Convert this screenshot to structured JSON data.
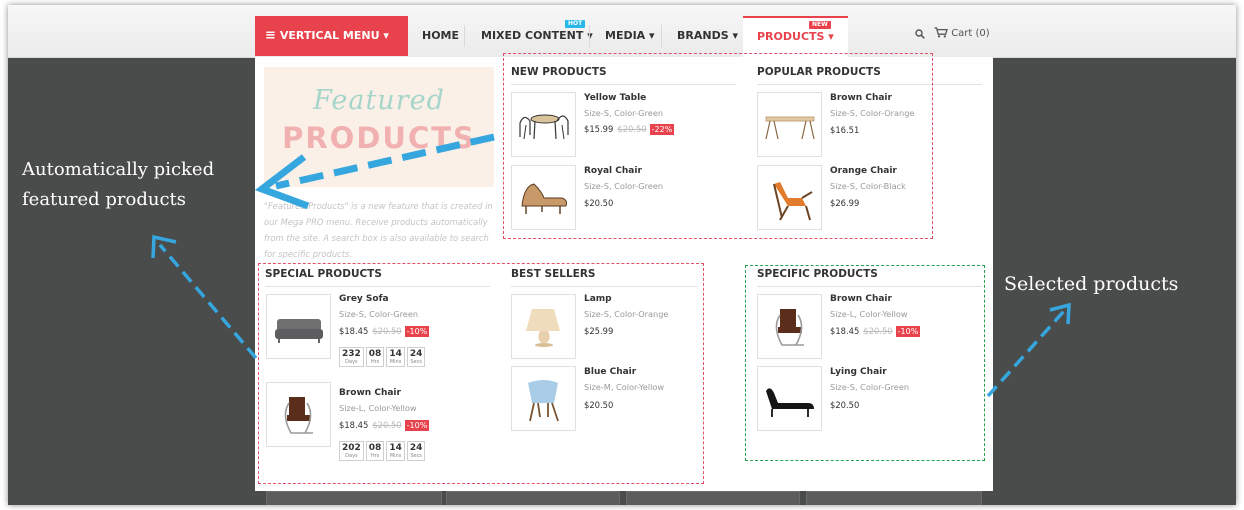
{
  "navigation": {
    "vertical_menu": "VERTICAL MENU",
    "vertical_menu_arrow": "▾",
    "home": "HOME",
    "mixed_content": "MIXED CONTENT",
    "mixed_content_badge": "HOT",
    "media": "MEDIA",
    "brands": "BRANDS",
    "products": "PRODUCTS",
    "products_badge": "NEW",
    "dropdown_arrow": "▾",
    "search_icon": "search-icon",
    "cart_icon": "cart-icon",
    "cart_label": "Cart (0)"
  },
  "featured": {
    "script_text": "Featured",
    "block_text": "PRODUCTS",
    "description": "\"Featured Products\" is a new feature that is created in our Mega PRO menu. Receive products automatically from the site. A search box is also available to search for specific products."
  },
  "sections": {
    "new_products": {
      "title": "NEW PRODUCTS",
      "items": [
        {
          "name": "Yellow Table",
          "attributes": "Size-S, Color-Green",
          "price": "$15.99",
          "old_price": "$20.50",
          "discount": "-22%"
        },
        {
          "name": "Royal Chair",
          "attributes": "Size-S, Color-Green",
          "price": "$20.50"
        }
      ]
    },
    "popular_products": {
      "title": "POPULAR PRODUCTS",
      "items": [
        {
          "name": "Brown Chair",
          "attributes": "Size-S, Color-Orange",
          "price": "$16.51"
        },
        {
          "name": "Orange Chair",
          "attributes": "Size-S, Color-Black",
          "price": "$26.99"
        }
      ]
    },
    "special_products": {
      "title": "SPECIAL PRODUCTS",
      "items": [
        {
          "name": "Grey Sofa",
          "attributes": "Size-S, Color-Green",
          "price": "$18.45",
          "old_price": "$20.50",
          "discount": "-10%",
          "countdown": {
            "days": "232",
            "hrs": "08",
            "mins": "14",
            "secs": "24"
          }
        },
        {
          "name": "Brown Chair",
          "attributes": "Size-L, Color-Yellow",
          "price": "$18.45",
          "old_price": "$20.50",
          "discount": "-10%",
          "countdown": {
            "days": "202",
            "hrs": "08",
            "mins": "14",
            "secs": "24"
          }
        }
      ]
    },
    "best_sellers": {
      "title": "BEST SELLERS",
      "items": [
        {
          "name": "Lamp",
          "attributes": "Size-S, Color-Orange",
          "price": "$25.99"
        },
        {
          "name": "Blue Chair",
          "attributes": "Size-M, Color-Yellow",
          "price": "$20.50"
        }
      ]
    },
    "specific_products": {
      "title": "SPECIFIC PRODUCTS",
      "items": [
        {
          "name": "Brown Chair",
          "attributes": "Size-L, Color-Yellow",
          "price": "$18.45",
          "old_price": "$20.50",
          "discount": "-10%"
        },
        {
          "name": "Lying Chair",
          "attributes": "Size-S, Color-Green",
          "price": "$20.50"
        }
      ]
    }
  },
  "countdown_labels": {
    "days": "Days",
    "hrs": "Hrs",
    "mins": "Mins",
    "secs": "Secs"
  },
  "annotations": {
    "left_line1": "Automatically picked",
    "left_line2": "featured products",
    "right": "Selected products"
  },
  "colors": {
    "accent_red": "#e8434c",
    "hot_badge": "#29b6e8",
    "arrow_blue": "#36a6de",
    "highlight_red_dash": "#e0506a",
    "highlight_green_dash": "#25a04a"
  }
}
